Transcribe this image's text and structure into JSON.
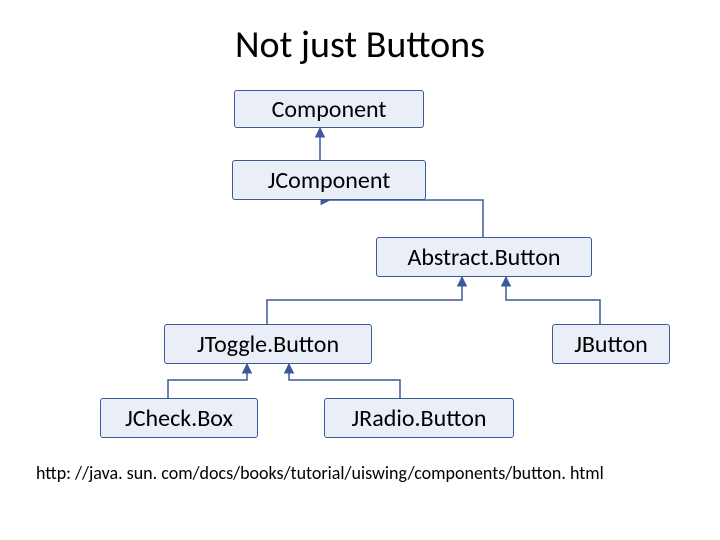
{
  "title": "Not just Buttons",
  "nodes": {
    "component": "Component",
    "jcomponent": "JComponent",
    "abstractbutton": "Abstract.Button",
    "jtogglebutton": "JToggle.Button",
    "jbutton": "JButton",
    "jcheckbox": "JCheck.Box",
    "jradiobutton": "JRadio.Button"
  },
  "url": "http: //java. sun. com/docs/books/tutorial/uiswing/components/button. html",
  "colors": {
    "node_fill": "#e9eef7",
    "node_border": "#3c5a9a"
  }
}
